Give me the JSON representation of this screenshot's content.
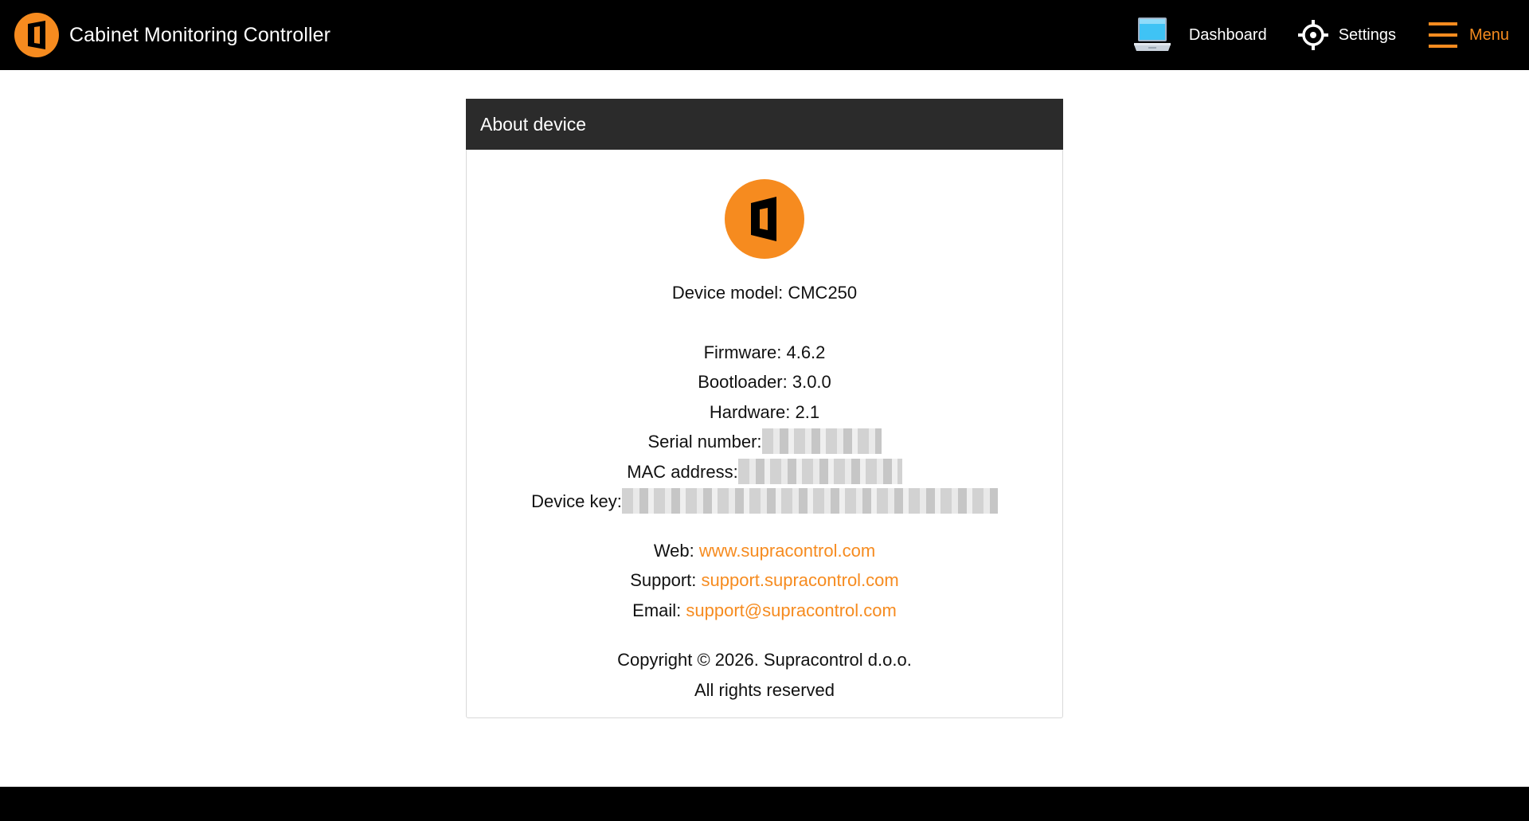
{
  "header": {
    "title": "Cabinet Monitoring Controller",
    "nav": {
      "dashboard": "Dashboard",
      "settings": "Settings",
      "menu": "Menu"
    }
  },
  "about": {
    "card_title": "About device",
    "device_model_label": "Device model: ",
    "device_model": "CMC250",
    "firmware_label": "Firmware: ",
    "firmware": "4.6.2",
    "bootloader_label": "Bootloader: ",
    "bootloader": "3.0.0",
    "hardware_label": "Hardware: ",
    "hardware": "2.1",
    "serial_label": "Serial number:",
    "mac_label": "MAC address:",
    "key_label": "Device key:",
    "web_label": "Web: ",
    "web_link": "www.supracontrol.com",
    "support_label": "Support: ",
    "support_link": "support.supracontrol.com",
    "email_label": "Email: ",
    "email_link": "support@supracontrol.com",
    "copyright": "Copyright © 2026. Supracontrol d.o.o.",
    "rights": "All rights reserved"
  },
  "colors": {
    "accent": "#f68b1f",
    "topbar": "#000000",
    "card_header": "#2b2b2b"
  },
  "icons": [
    "brand-logo-icon",
    "laptop-icon",
    "gear-icon",
    "hamburger-menu-icon"
  ]
}
